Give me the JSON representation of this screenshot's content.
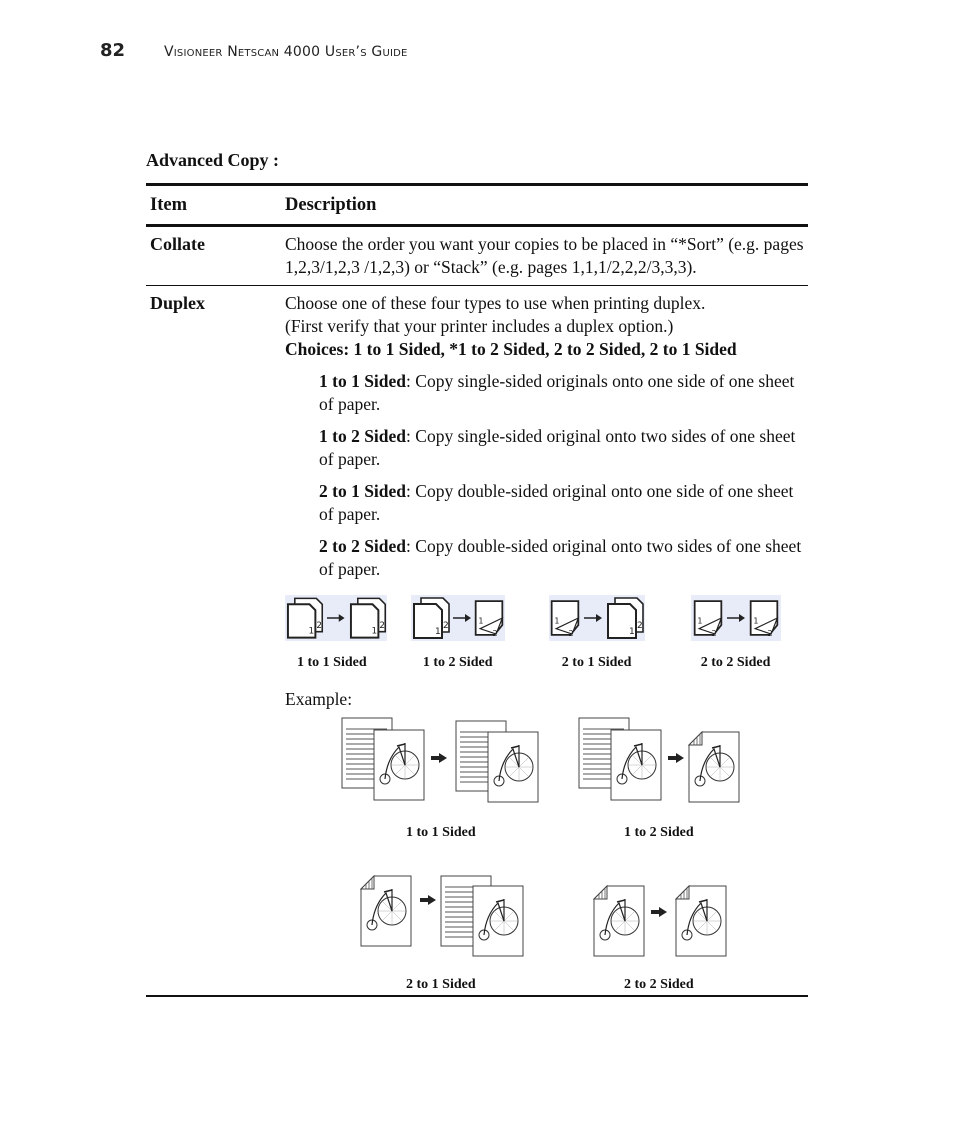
{
  "header": {
    "page_number": "82",
    "book_title": "Visioneer Netscan 4000 User’s Guide"
  },
  "section_title": "Advanced Copy :",
  "table": {
    "columns": [
      "Item",
      "Description"
    ],
    "rows": [
      {
        "item": "Collate",
        "description": "Choose the order you want your copies to be placed in “*Sort” (e.g. pages 1,2,3/1,2,3 /1,2,3) or “Stack” (e.g. pages 1,1,1/2,2,2/3,3,3)."
      },
      {
        "item": "Duplex",
        "description_line1": "Choose one of these four types to use when printing duplex.",
        "description_line2": "(First verify that your printer includes a duplex option.)",
        "choices": "Choices: 1 to 1 Sided, *1 to 2 Sided, 2 to 2 Sided, 2 to 1 Sided",
        "options": [
          {
            "name": "1 to 1 Sided",
            "text": ": Copy single-sided originals onto one side of one sheet of paper."
          },
          {
            "name": "1 to 2 Sided",
            "text": ": Copy single-sided original onto two sides of one sheet of paper."
          },
          {
            "name": "2 to 1 Sided",
            "text": ": Copy double-sided original onto one side of one sheet of paper."
          },
          {
            "name": "2 to 2 Sided",
            "text": ": Copy double-sided original onto two sides of one sheet of paper."
          }
        ],
        "icons": [
          {
            "label": "1 to 1 Sided",
            "icon": "duplex-1-to-1-icon"
          },
          {
            "label": "1 to 2 Sided",
            "icon": "duplex-1-to-2-icon"
          },
          {
            "label": "2 to 1 Sided",
            "icon": "duplex-2-to-1-icon"
          },
          {
            "label": "2 to 2 Sided",
            "icon": "duplex-2-to-2-icon"
          }
        ],
        "example_label": "Example:",
        "examples": [
          {
            "label": "1 to 1 Sided"
          },
          {
            "label": "1 to 2 Sided"
          },
          {
            "label": "2 to 1 Sided"
          },
          {
            "label": "2 to 2 Sided"
          }
        ]
      }
    ]
  }
}
